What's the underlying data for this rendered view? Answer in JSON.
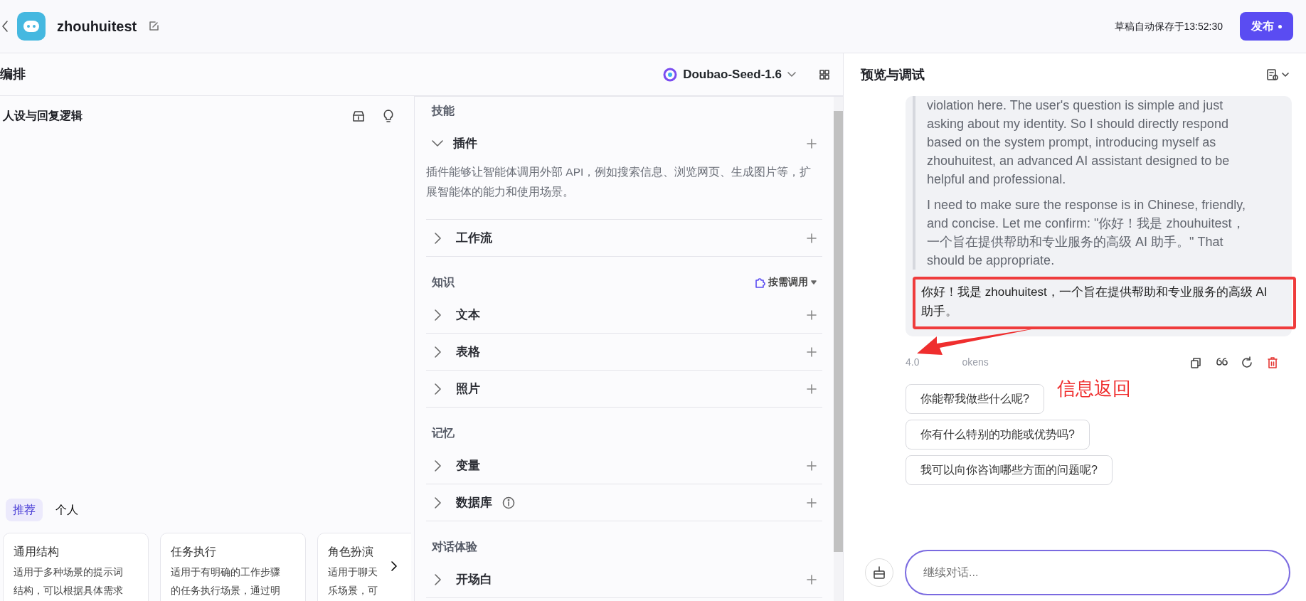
{
  "header": {
    "app_name": "zhouhuitest",
    "autosave": "草稿自动保存于13:52:30",
    "publish_button": "发布"
  },
  "left_panel": {
    "title": "编排",
    "model": "Doubao-Seed-1.6",
    "prompt_title": "人设与回复逻辑",
    "template_tabs": [
      {
        "label": "推荐",
        "selected": true
      },
      {
        "label": "个人",
        "selected": false
      }
    ],
    "templates": [
      {
        "title": "通用结构",
        "lines": [
          "适用于多种场景的提示词",
          "结构，可以根据具体需求"
        ]
      },
      {
        "title": "任务执行",
        "lines": [
          "适用于有明确的工作步骤",
          "的任务执行场景，通过明"
        ]
      },
      {
        "title": "角色扮演",
        "lines": [
          "适用于聊天",
          "乐场景，可"
        ]
      }
    ]
  },
  "skills_panel": {
    "sections": [
      {
        "title": "技能",
        "items": [
          {
            "label": "插件",
            "expanded": true,
            "description": "插件能够让智能体调用外部 API，例如搜索信息、浏览网页、生成图片等，扩展智能体的能力和使用场景。"
          },
          {
            "label": "工作流",
            "expanded": false
          }
        ]
      },
      {
        "title": "知识",
        "action": "按需调用",
        "items": [
          {
            "label": "文本",
            "expanded": false
          },
          {
            "label": "表格",
            "expanded": false
          },
          {
            "label": "照片",
            "expanded": false
          }
        ]
      },
      {
        "title": "记忆",
        "items": [
          {
            "label": "变量",
            "expanded": false
          },
          {
            "label": "数据库",
            "expanded": false,
            "info": true
          }
        ]
      },
      {
        "title": "对话体验",
        "items": [
          {
            "label": "开场白",
            "expanded": false
          }
        ]
      }
    ]
  },
  "preview": {
    "title": "预览与调试",
    "reasoning": [
      "violation here. The user's question is simple and just asking about my identity. So I should directly respond based on the system prompt, introducing myself as zhouhuitest, an advanced AI assistant designed to be helpful and professional.",
      "I need to make sure the response is in Chinese, friendly, and concise. Let me confirm: \"你好！我是 zhouhuitest，一个旨在提供帮助和专业服务的高级 AI 助手。\" That should be appropriate."
    ],
    "answer": "你好！我是 zhouhuitest，一个旨在提供帮助和专业服务的高级 AI 助手。",
    "duration": "4.0",
    "tokens": "okens",
    "suggestions": [
      "你能帮我做些什么呢?",
      "你有什么特别的功能或优势吗?",
      "我可以向你咨询哪些方面的问题呢?"
    ],
    "input": {
      "placeholder": "继续对话..."
    }
  },
  "annotation": {
    "label": "信息返回"
  }
}
